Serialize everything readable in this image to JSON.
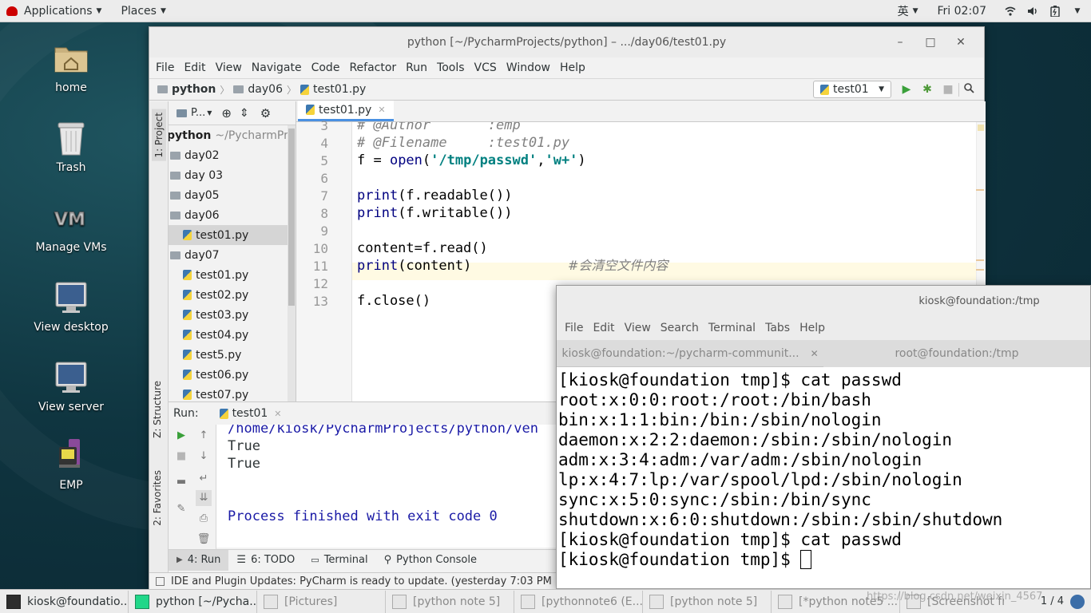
{
  "topbar": {
    "applications": "Applications",
    "places": "Places",
    "ime": "英",
    "clock": "Fri 02:07"
  },
  "desktop_icons": [
    {
      "label": "home",
      "icon": "home-folder-icon"
    },
    {
      "label": "Trash",
      "icon": "trash-icon"
    },
    {
      "label": "Manage VMs",
      "icon": "vm-icon"
    },
    {
      "label": "View desktop",
      "icon": "monitor-icon"
    },
    {
      "label": "View server",
      "icon": "monitor-icon"
    },
    {
      "label": "EMP",
      "icon": "emp-icon"
    }
  ],
  "ide": {
    "title": "python [~/PycharmProjects/python] – .../day06/test01.py",
    "menu": [
      "File",
      "Edit",
      "View",
      "Navigate",
      "Code",
      "Refactor",
      "Run",
      "Tools",
      "VCS",
      "Window",
      "Help"
    ],
    "breadcrumb": [
      "python",
      "day06",
      "test01.py"
    ],
    "run_config": "test01",
    "left_tabs": {
      "project": "1: Project",
      "structure": "Z: Structure",
      "favorites": "2: Favorites"
    },
    "project_panel": {
      "header": "P...",
      "root": "python",
      "root_path": "~/PycharmProjects",
      "items": [
        {
          "label": "day02",
          "kind": "folder"
        },
        {
          "label": "day 03",
          "kind": "folder"
        },
        {
          "label": "day05",
          "kind": "folder"
        },
        {
          "label": "day06",
          "kind": "folder"
        },
        {
          "label": "test01.py",
          "kind": "file",
          "selected": true
        },
        {
          "label": "day07",
          "kind": "folder"
        },
        {
          "label": "test01.py",
          "kind": "file"
        },
        {
          "label": "test02.py",
          "kind": "file"
        },
        {
          "label": "test03.py",
          "kind": "file"
        },
        {
          "label": "test04.py",
          "kind": "file"
        },
        {
          "label": "test5.py",
          "kind": "file"
        },
        {
          "label": "test06.py",
          "kind": "file"
        },
        {
          "label": "test07.py",
          "kind": "file"
        }
      ]
    },
    "editor": {
      "tab": "test01.py",
      "lines": [
        {
          "n": "3",
          "text": "# @Author       :emp"
        },
        {
          "n": "4",
          "text": "# @Filename     :test01.py"
        },
        {
          "n": "5",
          "text": "f = open('/tmp/passwd','w+')"
        },
        {
          "n": "6",
          "text": ""
        },
        {
          "n": "7",
          "text": "print(f.readable())"
        },
        {
          "n": "8",
          "text": "print(f.writable())"
        },
        {
          "n": "9",
          "text": ""
        },
        {
          "n": "10",
          "text": "content=f.read()"
        },
        {
          "n": "11",
          "text": "print(content)"
        },
        {
          "n": "12",
          "text": ""
        },
        {
          "n": "13",
          "text": "f.close()"
        }
      ],
      "line11_comment": "#会清空文件内容"
    },
    "run_panel": {
      "label": "Run:",
      "tab": "test01",
      "output": [
        "/home/kiosk/PycharmProjects/python/ven",
        "True",
        "True",
        "",
        "Process finished with exit code 0"
      ]
    },
    "bottom_tabs": [
      "4: Run",
      "6: TODO",
      "Terminal",
      "Python Console"
    ],
    "status": "IDE and Plugin Updates: PyCharm is ready to update. (yesterday 7:03 PM"
  },
  "terminal": {
    "title": "kiosk@foundation:/tmp",
    "menu": [
      "File",
      "Edit",
      "View",
      "Search",
      "Terminal",
      "Tabs",
      "Help"
    ],
    "tabs": [
      "kiosk@foundation:~/pycharm-communit...",
      "root@foundation:/tmp"
    ],
    "lines": [
      "[kiosk@foundation tmp]$ cat passwd",
      "root:x:0:0:root:/root:/bin/bash",
      "bin:x:1:1:bin:/bin:/sbin/nologin",
      "daemon:x:2:2:daemon:/sbin:/sbin/nologin",
      "adm:x:3:4:adm:/var/adm:/sbin/nologin",
      "lp:x:4:7:lp:/var/spool/lpd:/sbin/nologin",
      "sync:x:5:0:sync:/sbin:/bin/sync",
      "shutdown:x:6:0:shutdown:/sbin:/sbin/shutdown",
      "[kiosk@foundation tmp]$ cat passwd",
      "[kiosk@foundation tmp]$ "
    ]
  },
  "taskbar": {
    "items": [
      "kiosk@foundatio...",
      "python [~/Pycha...",
      "[Pictures]",
      "[python note 5]",
      "[pythonnote6 (E...",
      "[python note 5]",
      "[*python note5 ...",
      "[Screenshot fro..."
    ],
    "page": "1 / 4",
    "watermark": "https://blog.csdn.net/weixin_4567"
  }
}
